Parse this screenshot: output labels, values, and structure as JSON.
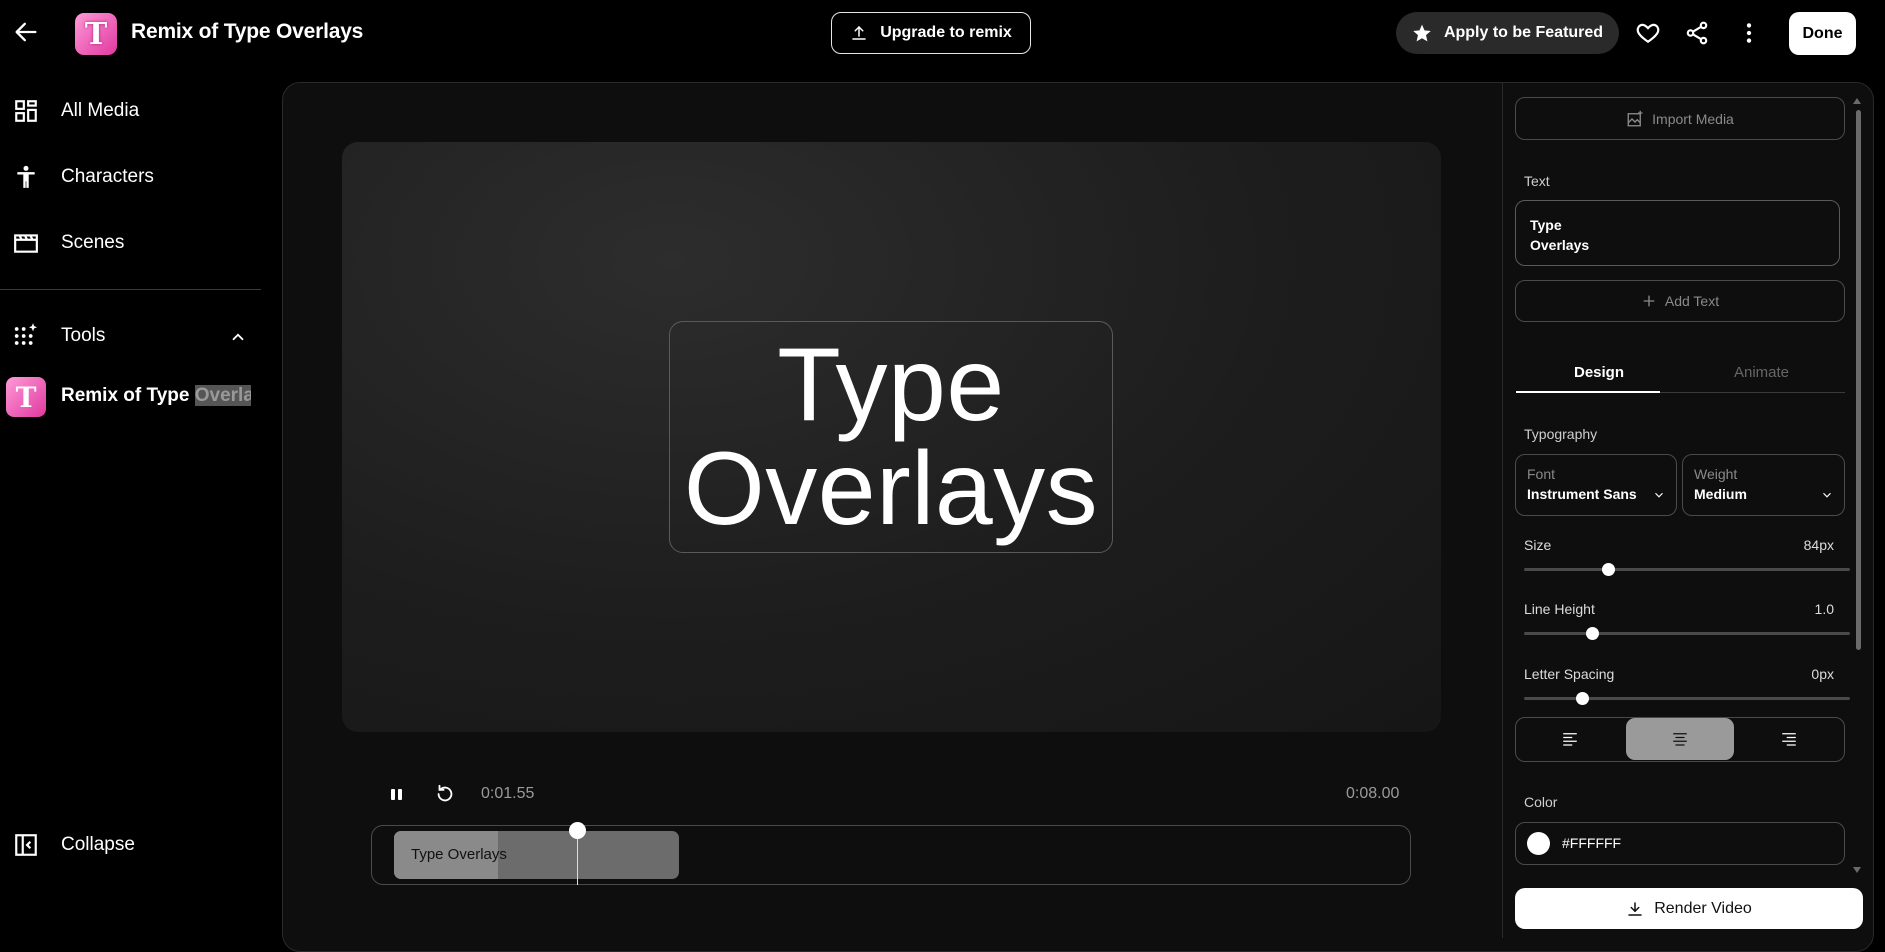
{
  "header": {
    "back_icon": "arrow-left-icon",
    "title": "Remix of Type Overlays",
    "upgrade_label": "Upgrade to remix",
    "featured_label": "Apply to be Featured",
    "done_label": "Done"
  },
  "sidebar": {
    "items": [
      {
        "label": "All Media",
        "icon": "grid-icon"
      },
      {
        "label": "Characters",
        "icon": "person-icon"
      },
      {
        "label": "Scenes",
        "icon": "film-icon"
      }
    ],
    "tools_label": "Tools",
    "project": {
      "label_start": "Remix of Type ",
      "label_highlight": "Overla",
      "label_end": "..."
    },
    "collapse_label": "Collapse"
  },
  "canvas": {
    "text_line1": "Type",
    "text_line2": "Overlays"
  },
  "player": {
    "current_time": "0:01.55",
    "total_time": "0:08.00",
    "clip_label": "Type Overlays"
  },
  "panel": {
    "import_label": "Import Media",
    "text_section": "Text",
    "text_card_line1": "Type",
    "text_card_line2": "Overlays",
    "add_text_label": "Add Text",
    "tabs": [
      "Design",
      "Animate"
    ],
    "typography_label": "Typography",
    "font": {
      "label": "Font",
      "value": "Instrument Sans"
    },
    "weight": {
      "label": "Weight",
      "value": "Medium"
    },
    "size": {
      "label": "Size",
      "value": "84px",
      "level": 0.26
    },
    "line_height": {
      "label": "Line Height",
      "value": "1.0",
      "level": 0.21
    },
    "letter_spacing": {
      "label": "Letter Spacing",
      "value": "0px",
      "level": 0.18
    },
    "alignment_selected": "center",
    "color_label": "Color",
    "color_value": "#FFFFFF",
    "render_label": "Render Video"
  },
  "colors": {
    "background": "#000000",
    "panel": "#0e0e0e",
    "brand_pink": "#e0389f"
  }
}
